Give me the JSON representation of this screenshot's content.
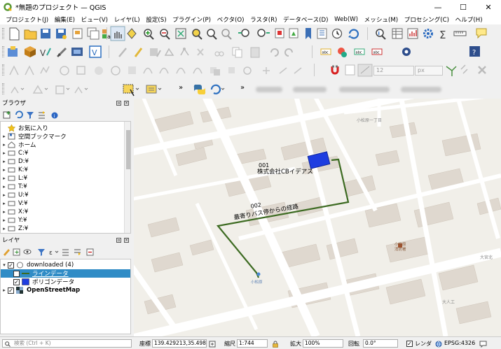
{
  "window": {
    "title": "*無題のプロジェクト — QGIS",
    "minimize": "—",
    "maximize": "☐",
    "close": "✕"
  },
  "menu": [
    "プロジェクト(J)",
    "編集(E)",
    "ビュー(V)",
    "レイヤ(L)",
    "設定(S)",
    "プラグイン(P)",
    "ベクタ(O)",
    "ラスタ(R)",
    "データベース(D)",
    "Web(W)",
    "メッシュ(M)",
    "プロセシング(C)",
    "ヘルプ(H)"
  ],
  "toolbar": {
    "font_size": "12",
    "font_unit": "px",
    "overflow": "»"
  },
  "browser": {
    "title": "ブラウザ",
    "items": [
      "お気に入り",
      "空間ブックマーク",
      "ホーム",
      "C:¥",
      "D:¥",
      "K:¥",
      "L:¥",
      "T:¥",
      "U:¥",
      "V:¥",
      "X:¥",
      "Y:¥",
      "Z:¥"
    ]
  },
  "layers": {
    "title": "レイヤ",
    "group": "downloaded (4)",
    "items": [
      "ラインデータ",
      "ポリゴンデータ"
    ],
    "basemap": "OpenStreetMap"
  },
  "map": {
    "labels": {
      "poi1_code": "001",
      "poi1_name": "株式会社CBイデアス",
      "route_code": "002",
      "route_name": "最寄りバス停からの経路",
      "street1": "小松原一丁目",
      "bus_stop": "小松原",
      "school": "小松原\n消防署",
      "area1": "大宮北",
      "area2": "大人工"
    }
  },
  "status": {
    "search_placeholder": "検索 (Ctrl + K)",
    "coord_label": "座標",
    "coord_value": "139.429213,35.498505",
    "scale_label": "縮尺",
    "scale_value": "1:744",
    "mag_label": "拡大",
    "mag_value": "100%",
    "rot_label": "回転",
    "rot_value": "0.0°",
    "render_label": "レンダ",
    "crs": "EPSG:4326"
  },
  "colors": {
    "accent": "#308cc6",
    "route": "#3d6b22",
    "poi": "#1e3de0",
    "selected": "#308cc6"
  }
}
